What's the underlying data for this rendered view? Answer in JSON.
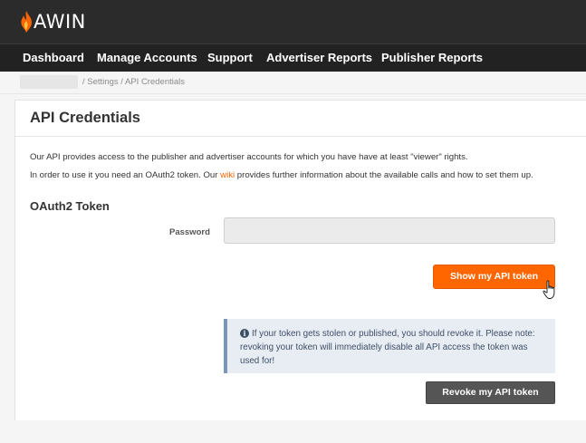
{
  "header": {
    "brand": "AWIN",
    "brand_colors": {
      "flame": "#ff6600",
      "background": "#2b2b2b"
    },
    "logo_icon": "flame-icon"
  },
  "nav": {
    "items": [
      "Dashboard",
      "Manage Accounts",
      "Support",
      "Advertiser Reports",
      "Publisher Reports"
    ]
  },
  "breadcrumb": {
    "trail": "/ Settings / API Credentials"
  },
  "page": {
    "title": "API Credentials",
    "intro": "Our API provides access to the publisher and advertiser accounts for which you have have at least \"viewer\" rights.",
    "usage_prefix": "In order to use it you need an OAuth2 token. Our ",
    "usage_link": "wiki",
    "usage_suffix": " provides further information about the available calls and how to set them up."
  },
  "oauth": {
    "section_title": "OAuth2 Token",
    "password_label": "Password",
    "password_value": "",
    "show_button": "Show my API token",
    "alert_icon": "info-icon",
    "alert_text": "If your token gets stolen or published, you should revoke it. Please note: revoking your token will immediately disable all API access the token was used for!",
    "revoke_button": "Revoke my API token"
  },
  "colors": {
    "accent": "#ff6600",
    "link": "#ff6600",
    "alert_bg": "#e8edf4",
    "alert_border": "#7a97b9",
    "secondary_button": "#555555"
  },
  "cursor_icon": "hand-pointer-icon"
}
